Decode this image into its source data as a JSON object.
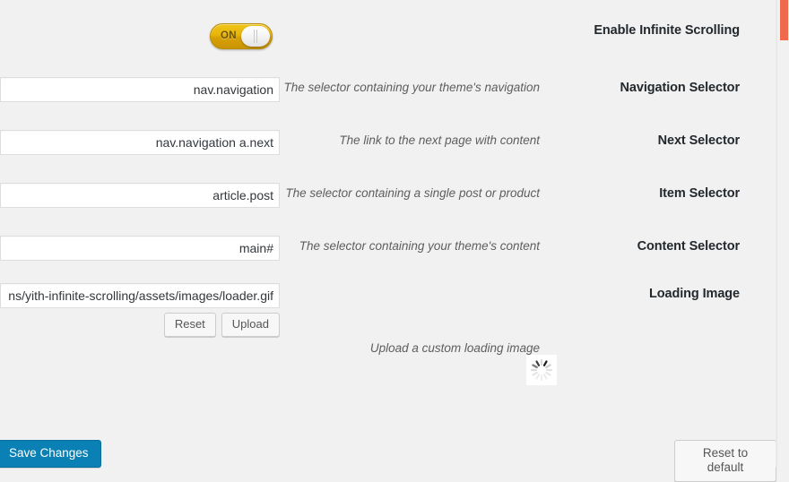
{
  "rows": [
    {
      "name": "enable-infinite-scrolling",
      "label": "Enable Infinite Scrolling",
      "description": "",
      "control": "toggle",
      "toggle_state": "ON"
    },
    {
      "name": "navigation-selector",
      "label": "Navigation Selector",
      "description": "The selector containing your theme's navigation",
      "control": "text",
      "value": "nav.navigation",
      "placeholder": ""
    },
    {
      "name": "next-selector",
      "label": "Next Selector",
      "description": "The link to the next page with content",
      "control": "text",
      "value": "nav.navigation a.next",
      "placeholder": ""
    },
    {
      "name": "item-selector",
      "label": "Item Selector",
      "description": "The selector containing a single post or product",
      "control": "text",
      "value": "article.post",
      "placeholder": ""
    },
    {
      "name": "content-selector",
      "label": "Content Selector",
      "description": "The selector containing your theme's content",
      "control": "text",
      "value": "main#",
      "placeholder": ""
    },
    {
      "name": "loading-image",
      "label": "Loading Image",
      "description": "Upload a custom loading image",
      "control": "upload",
      "value": "ns/yith-infinite-scrolling/assets/images/loader.gif",
      "placeholder": "",
      "reset_label": "Reset",
      "upload_label": "Upload"
    }
  ],
  "footer": {
    "save_label": "Save Changes",
    "reset_default_label": "Reset to default"
  },
  "icons": {
    "loader": "spinner-icon"
  },
  "colors": {
    "accent_blue": "#0b80b4",
    "toggle_on": "#e8b409",
    "scrollbar_thumb": "#ef6a4c",
    "page_background": "#f1f1f1"
  }
}
